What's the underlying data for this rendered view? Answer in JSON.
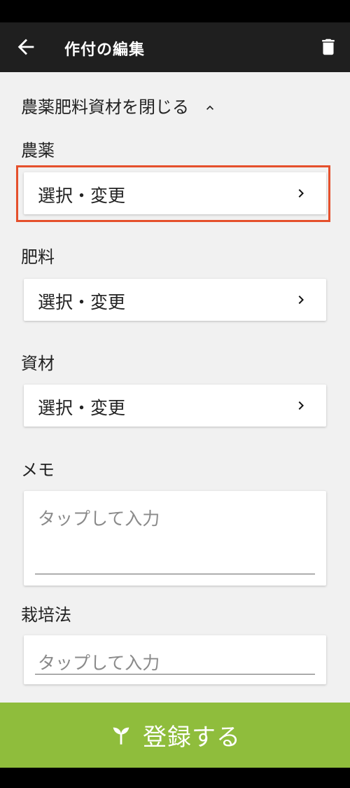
{
  "app_bar": {
    "title": "作付の編集"
  },
  "toggle": {
    "label": "農薬肥料資材を閉じる"
  },
  "sections": {
    "pesticide": {
      "label": "農薬",
      "button": "選択・変更"
    },
    "fertilizer": {
      "label": "肥料",
      "button": "選択・変更"
    },
    "material": {
      "label": "資材",
      "button": "選択・変更"
    }
  },
  "memo": {
    "label": "メモ",
    "placeholder": "タップして入力"
  },
  "cultivation": {
    "label": "栽培法",
    "placeholder": "タップして入力"
  },
  "footer": {
    "button": "登録する"
  },
  "colors": {
    "app_bar": "#1f1f1f",
    "highlight": "#e5502c",
    "footer": "#8fbd3c"
  }
}
